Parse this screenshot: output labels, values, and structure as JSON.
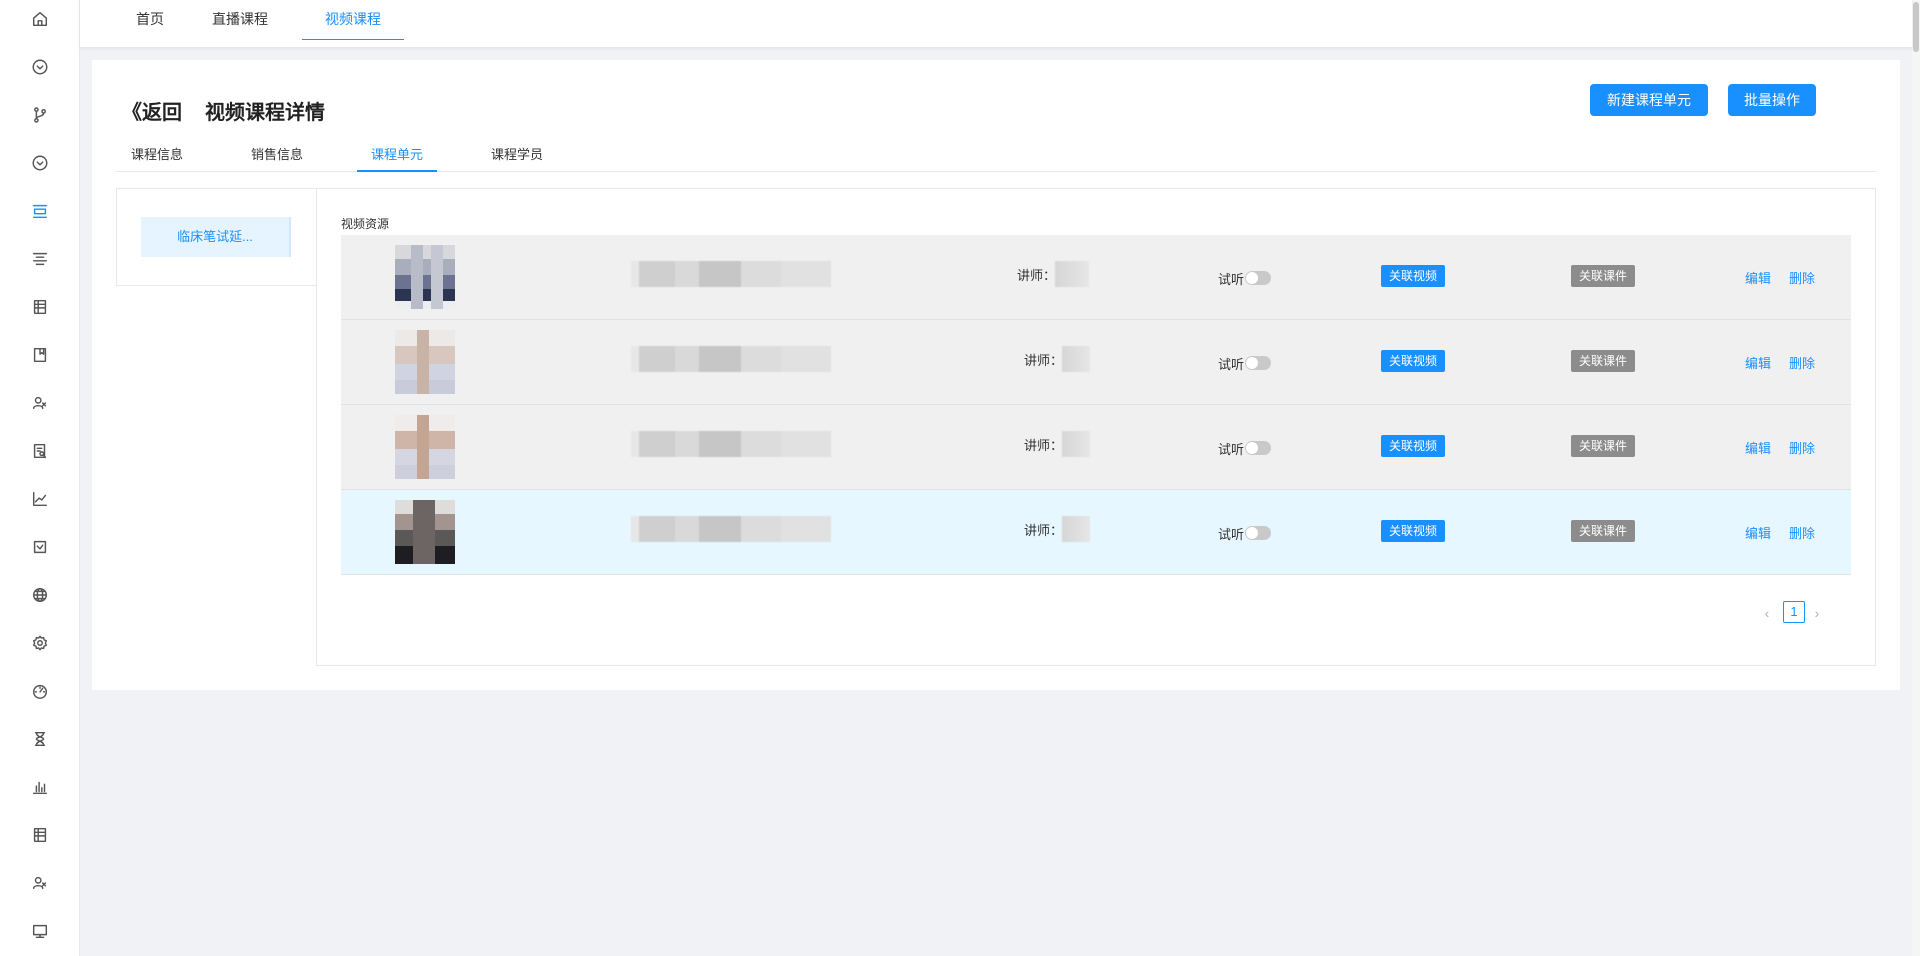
{
  "rail": {
    "icons": [
      "home-icon",
      "circle-check-icon",
      "branch-icon",
      "circle-check-icon",
      "list-active-icon",
      "align-center-icon",
      "table-icon",
      "book-icon",
      "users-icon",
      "document-search-icon",
      "line-chart-icon",
      "checkbox-icon",
      "globe-icon",
      "settings-icon",
      "dashboard-icon",
      "hourglass-icon",
      "bar-chart-icon",
      "table-icon",
      "users-icon",
      "monitor-icon"
    ],
    "active_index": 4
  },
  "topnav": {
    "tabs": [
      "首页",
      "直播课程",
      "视频课程"
    ],
    "active": "视频课程"
  },
  "header": {
    "back_label": "《返回",
    "title": "视频课程详情",
    "new_unit_button": "新建课程单元",
    "batch_button": "批量操作"
  },
  "subtabs": {
    "items": [
      "课程信息",
      "销售信息",
      "课程单元",
      "课程学员"
    ],
    "active": "课程单元"
  },
  "unit_panel": {
    "selected_unit": "临床笔试延..."
  },
  "content": {
    "section_label": "视频资源",
    "rows": [
      {
        "teacher_label": "讲师：",
        "preview_label": "试听",
        "preview_on": false,
        "link_video": "关联视频",
        "link_courseware": "关联课件",
        "edit": "编辑",
        "delete": "删除"
      },
      {
        "teacher_label": "讲师：",
        "preview_label": "试听",
        "preview_on": false,
        "link_video": "关联视频",
        "link_courseware": "关联课件",
        "edit": "编辑",
        "delete": "删除"
      },
      {
        "teacher_label": "讲师：",
        "preview_label": "试听",
        "preview_on": false,
        "link_video": "关联视频",
        "link_courseware": "关联课件",
        "edit": "编辑",
        "delete": "删除"
      },
      {
        "teacher_label": "讲师：",
        "preview_label": "试听",
        "preview_on": false,
        "link_video": "关联视频",
        "link_courseware": "关联课件",
        "edit": "编辑",
        "delete": "删除"
      }
    ]
  },
  "pagination": {
    "current_page": "1",
    "prev": "‹",
    "next": "›"
  },
  "colors": {
    "accent": "#1890ff",
    "courseware_button": "#8c8c8c",
    "highlight_row": "#e6f7ff",
    "row_bg": "#f0f0f0",
    "page_bg": "#f0f2f5"
  }
}
